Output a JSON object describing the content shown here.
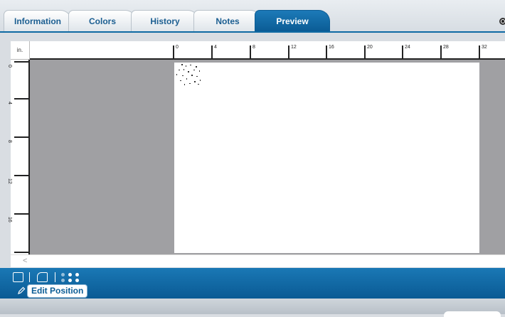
{
  "tabs": [
    {
      "label": "Information",
      "active": false
    },
    {
      "label": "Colors",
      "active": false
    },
    {
      "label": "History",
      "active": false
    },
    {
      "label": "Notes",
      "active": false
    },
    {
      "label": "Preview",
      "active": true
    }
  ],
  "ruler": {
    "unit": "in.",
    "h_ticks": [
      "0",
      "4",
      "8",
      "12",
      "16",
      "20",
      "24",
      "28",
      "32"
    ],
    "v_ticks": [
      "0",
      "4",
      "8",
      "12",
      "16"
    ]
  },
  "scroll_left": "<",
  "toolbar": {
    "edit_position_label": "Edit Position",
    "icons": [
      "image-view-icon",
      "crop-view-icon",
      "dots-menu-icon",
      "pencil-icon"
    ]
  },
  "colors": {
    "accent": "#0b5c95",
    "canvas": "#a0a0a3"
  }
}
